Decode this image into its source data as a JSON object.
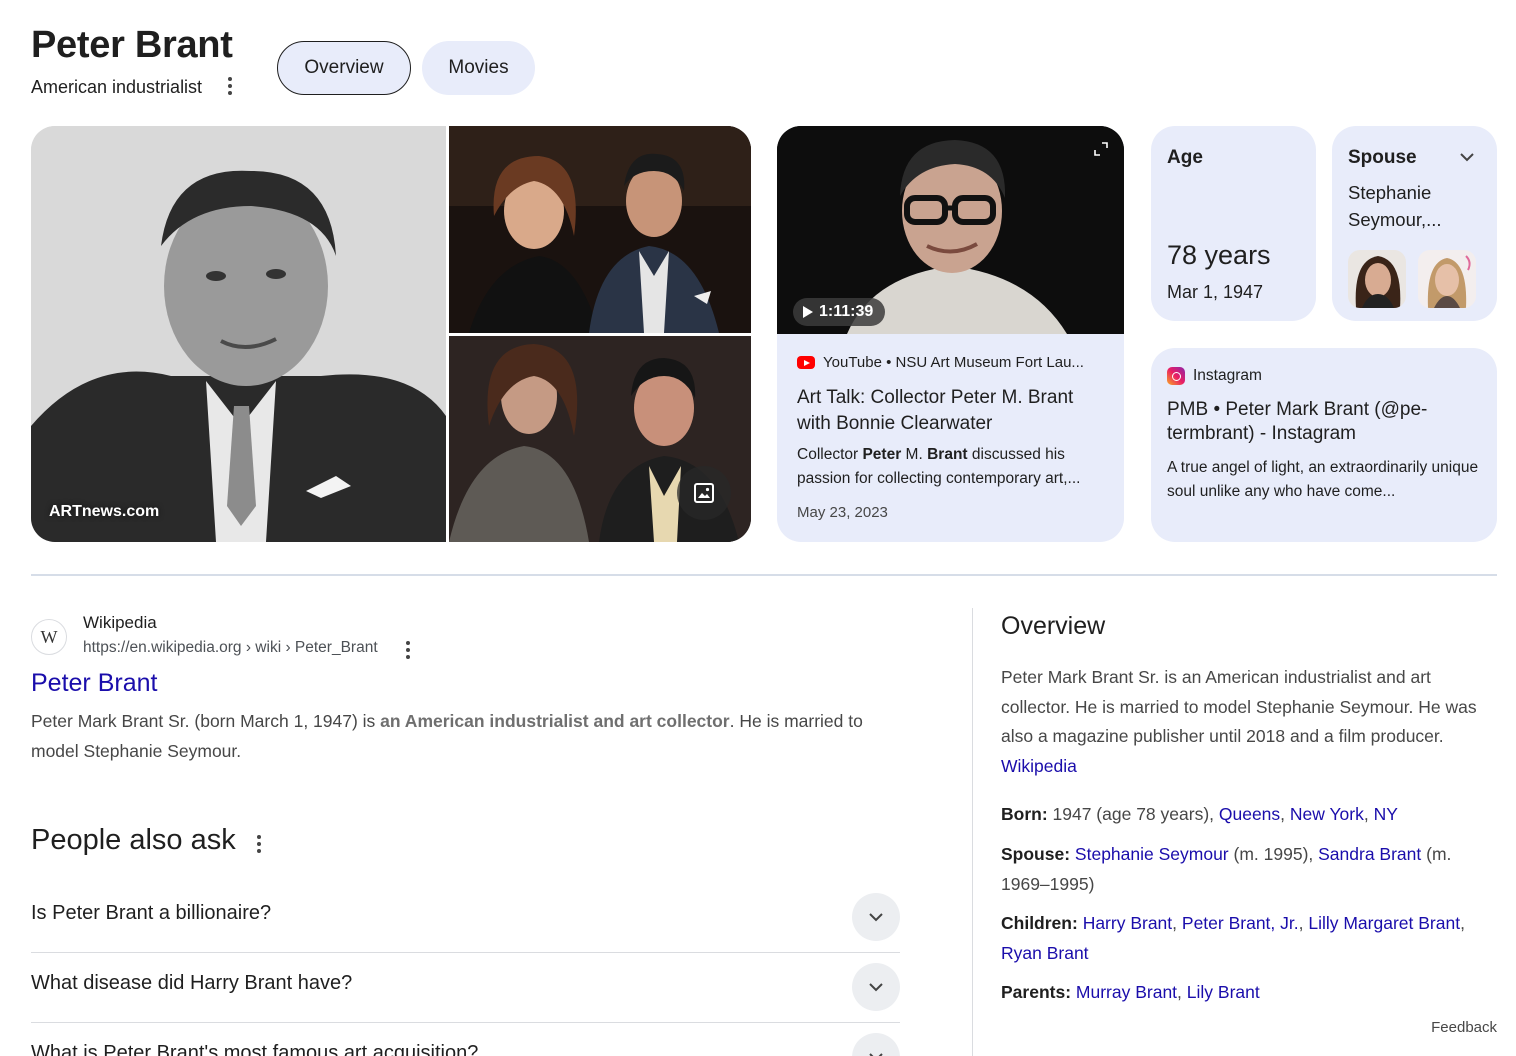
{
  "header": {
    "title": "Peter Brant",
    "subtitle": "American industrialist",
    "chips": [
      "Overview",
      "Movies"
    ]
  },
  "images": {
    "source_label": "ARTnews.com"
  },
  "video": {
    "duration": "1:11:39",
    "source": "YouTube • NSU Art Museum Fort Lau...",
    "title": "Art Talk: Collector Peter M. Brant with Bonnie Clearwater",
    "desc_pre": "Collector ",
    "desc_bold1": "Peter",
    "desc_mid": " M. ",
    "desc_bold2": "Brant",
    "desc_post": " discussed his passion for collecting contemporary art,...",
    "date": "May 23, 2023"
  },
  "age": {
    "label": "Age",
    "value": "78 years",
    "date": "Mar 1, 1947"
  },
  "spouse": {
    "label": "Spouse",
    "value": "Stephanie Seymour,..."
  },
  "instagram": {
    "source": "Instagram",
    "title": "PMB • Peter Mark Brant (@pe-termbrant) - Instagram",
    "desc": "A true angel of light, an extraordinarily unique soul unlike any who have come..."
  },
  "wiki_result": {
    "site": "Wikipedia",
    "url": "https://en.wikipedia.org › wiki › Peter_Brant",
    "favicon_letter": "W",
    "link": "Peter Brant",
    "snippet_pre": "Peter Mark Brant Sr. (born March 1, 1947) is ",
    "snippet_bold": "an American industrialist and art collector",
    "snippet_post": ". He is married to model Stephanie Seymour."
  },
  "people_also_ask": {
    "title": "People also ask",
    "questions": [
      "Is Peter Brant a billionaire?",
      "What disease did Harry Brant have?",
      "What is Peter Brant's most famous art acquisition?"
    ]
  },
  "overview": {
    "title": "Overview",
    "description": "Peter Mark Brant Sr. is an American industrialist and art collector. He is married to model Stephanie Seymour. He was also a magazine publisher until 2018 and a film producer. ",
    "source_link": "Wikipedia",
    "born": {
      "label": "Born:",
      "text": " 1947 (age 78 years), ",
      "links": [
        "Queens",
        "New York",
        "NY"
      ]
    },
    "spouse": {
      "label": "Spouse:",
      "link1": "Stephanie Seymour",
      "text1": " (m. 1995), ",
      "link2": "Sandra Brant",
      "text2": " (m. 1969–1995)"
    },
    "children": {
      "label": "Children:",
      "links": [
        "Harry Brant",
        "Peter Brant, Jr.",
        "Lilly Margaret Brant",
        "Ryan Brant"
      ]
    },
    "parents": {
      "label": "Parents:",
      "links": [
        "Murray Brant",
        "Lily Brant"
      ]
    }
  },
  "feedback": "Feedback",
  "colors": {
    "link": "#1a0dab",
    "card_bg": "#e8ecfa",
    "text": "#1f1f1f",
    "muted": "#474747"
  }
}
